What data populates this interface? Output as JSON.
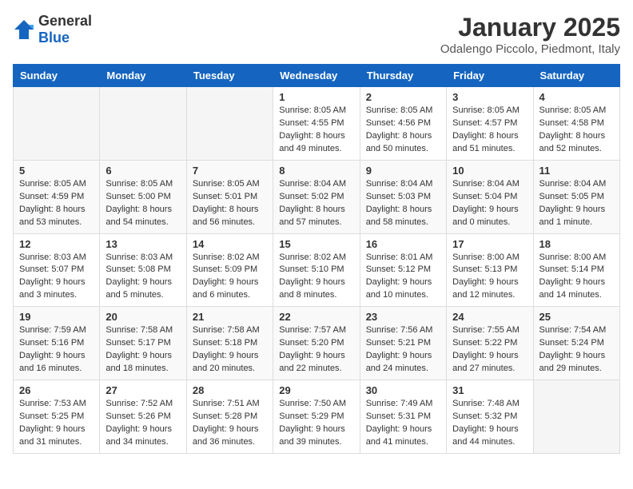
{
  "header": {
    "logo_general": "General",
    "logo_blue": "Blue",
    "month": "January 2025",
    "location": "Odalengo Piccolo, Piedmont, Italy"
  },
  "weekdays": [
    "Sunday",
    "Monday",
    "Tuesday",
    "Wednesday",
    "Thursday",
    "Friday",
    "Saturday"
  ],
  "weeks": [
    [
      {
        "day": "",
        "info": ""
      },
      {
        "day": "",
        "info": ""
      },
      {
        "day": "",
        "info": ""
      },
      {
        "day": "1",
        "info": "Sunrise: 8:05 AM\nSunset: 4:55 PM\nDaylight: 8 hours\nand 49 minutes."
      },
      {
        "day": "2",
        "info": "Sunrise: 8:05 AM\nSunset: 4:56 PM\nDaylight: 8 hours\nand 50 minutes."
      },
      {
        "day": "3",
        "info": "Sunrise: 8:05 AM\nSunset: 4:57 PM\nDaylight: 8 hours\nand 51 minutes."
      },
      {
        "day": "4",
        "info": "Sunrise: 8:05 AM\nSunset: 4:58 PM\nDaylight: 8 hours\nand 52 minutes."
      }
    ],
    [
      {
        "day": "5",
        "info": "Sunrise: 8:05 AM\nSunset: 4:59 PM\nDaylight: 8 hours\nand 53 minutes."
      },
      {
        "day": "6",
        "info": "Sunrise: 8:05 AM\nSunset: 5:00 PM\nDaylight: 8 hours\nand 54 minutes."
      },
      {
        "day": "7",
        "info": "Sunrise: 8:05 AM\nSunset: 5:01 PM\nDaylight: 8 hours\nand 56 minutes."
      },
      {
        "day": "8",
        "info": "Sunrise: 8:04 AM\nSunset: 5:02 PM\nDaylight: 8 hours\nand 57 minutes."
      },
      {
        "day": "9",
        "info": "Sunrise: 8:04 AM\nSunset: 5:03 PM\nDaylight: 8 hours\nand 58 minutes."
      },
      {
        "day": "10",
        "info": "Sunrise: 8:04 AM\nSunset: 5:04 PM\nDaylight: 9 hours\nand 0 minutes."
      },
      {
        "day": "11",
        "info": "Sunrise: 8:04 AM\nSunset: 5:05 PM\nDaylight: 9 hours\nand 1 minute."
      }
    ],
    [
      {
        "day": "12",
        "info": "Sunrise: 8:03 AM\nSunset: 5:07 PM\nDaylight: 9 hours\nand 3 minutes."
      },
      {
        "day": "13",
        "info": "Sunrise: 8:03 AM\nSunset: 5:08 PM\nDaylight: 9 hours\nand 5 minutes."
      },
      {
        "day": "14",
        "info": "Sunrise: 8:02 AM\nSunset: 5:09 PM\nDaylight: 9 hours\nand 6 minutes."
      },
      {
        "day": "15",
        "info": "Sunrise: 8:02 AM\nSunset: 5:10 PM\nDaylight: 9 hours\nand 8 minutes."
      },
      {
        "day": "16",
        "info": "Sunrise: 8:01 AM\nSunset: 5:12 PM\nDaylight: 9 hours\nand 10 minutes."
      },
      {
        "day": "17",
        "info": "Sunrise: 8:00 AM\nSunset: 5:13 PM\nDaylight: 9 hours\nand 12 minutes."
      },
      {
        "day": "18",
        "info": "Sunrise: 8:00 AM\nSunset: 5:14 PM\nDaylight: 9 hours\nand 14 minutes."
      }
    ],
    [
      {
        "day": "19",
        "info": "Sunrise: 7:59 AM\nSunset: 5:16 PM\nDaylight: 9 hours\nand 16 minutes."
      },
      {
        "day": "20",
        "info": "Sunrise: 7:58 AM\nSunset: 5:17 PM\nDaylight: 9 hours\nand 18 minutes."
      },
      {
        "day": "21",
        "info": "Sunrise: 7:58 AM\nSunset: 5:18 PM\nDaylight: 9 hours\nand 20 minutes."
      },
      {
        "day": "22",
        "info": "Sunrise: 7:57 AM\nSunset: 5:20 PM\nDaylight: 9 hours\nand 22 minutes."
      },
      {
        "day": "23",
        "info": "Sunrise: 7:56 AM\nSunset: 5:21 PM\nDaylight: 9 hours\nand 24 minutes."
      },
      {
        "day": "24",
        "info": "Sunrise: 7:55 AM\nSunset: 5:22 PM\nDaylight: 9 hours\nand 27 minutes."
      },
      {
        "day": "25",
        "info": "Sunrise: 7:54 AM\nSunset: 5:24 PM\nDaylight: 9 hours\nand 29 minutes."
      }
    ],
    [
      {
        "day": "26",
        "info": "Sunrise: 7:53 AM\nSunset: 5:25 PM\nDaylight: 9 hours\nand 31 minutes."
      },
      {
        "day": "27",
        "info": "Sunrise: 7:52 AM\nSunset: 5:26 PM\nDaylight: 9 hours\nand 34 minutes."
      },
      {
        "day": "28",
        "info": "Sunrise: 7:51 AM\nSunset: 5:28 PM\nDaylight: 9 hours\nand 36 minutes."
      },
      {
        "day": "29",
        "info": "Sunrise: 7:50 AM\nSunset: 5:29 PM\nDaylight: 9 hours\nand 39 minutes."
      },
      {
        "day": "30",
        "info": "Sunrise: 7:49 AM\nSunset: 5:31 PM\nDaylight: 9 hours\nand 41 minutes."
      },
      {
        "day": "31",
        "info": "Sunrise: 7:48 AM\nSunset: 5:32 PM\nDaylight: 9 hours\nand 44 minutes."
      },
      {
        "day": "",
        "info": ""
      }
    ]
  ]
}
